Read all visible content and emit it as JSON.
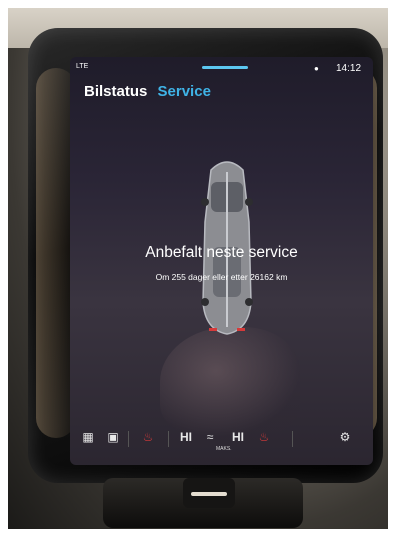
{
  "status_bar": {
    "signal": "LTE",
    "time": "14:12"
  },
  "tabs": [
    {
      "label": "Bilstatus"
    },
    {
      "label": "Service"
    }
  ],
  "service": {
    "heading": "Anbefalt neste service",
    "detail": "Om 255 dager eller etter 26162 km"
  },
  "dock": {
    "fan_left": "HI",
    "fan_right": "HI",
    "maks_label": "MAKS."
  },
  "colors": {
    "accent": "#3fb3e6",
    "indicator": "#5cc7f0",
    "heat_red": "#d63a3a"
  }
}
